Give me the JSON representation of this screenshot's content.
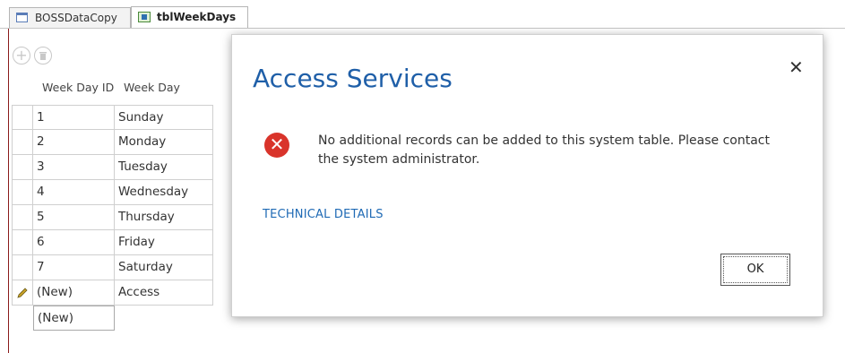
{
  "tabs": [
    {
      "label": "BOSSDataCopy"
    },
    {
      "label": "tblWeekDays"
    }
  ],
  "toolbar": {
    "add_icon": "plus-circle-icon",
    "delete_icon": "trash-circle-icon"
  },
  "grid": {
    "headers": [
      "Week Day ID",
      "Week Day"
    ],
    "rows": [
      {
        "id": "1",
        "day": "Sunday"
      },
      {
        "id": "2",
        "day": "Monday"
      },
      {
        "id": "3",
        "day": "Tuesday"
      },
      {
        "id": "4",
        "day": "Wednesday"
      },
      {
        "id": "5",
        "day": "Thursday"
      },
      {
        "id": "6",
        "day": "Friday"
      },
      {
        "id": "7",
        "day": "Saturday"
      },
      {
        "id": "(New)",
        "day": "Access"
      }
    ],
    "new_row": {
      "id": "(New)",
      "day": ""
    }
  },
  "dialog": {
    "title": "Access Services",
    "close_symbol": "✕",
    "error_symbol": "✕",
    "message": "No additional records can be added to this system table. Please contact the system administrator.",
    "details_link": "TECHNICAL DETAILS",
    "ok_label": "OK"
  },
  "colors": {
    "accent": "#1f5fa8",
    "error": "#d9342b",
    "link": "#1f6ab5"
  }
}
